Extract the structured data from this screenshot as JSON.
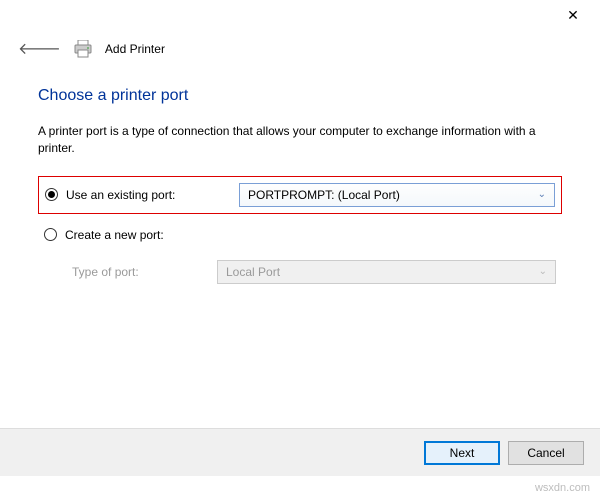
{
  "window": {
    "header_title": "Add Printer"
  },
  "page": {
    "title": "Choose a printer port",
    "description": "A printer port is a type of connection that allows your computer to exchange information with a printer."
  },
  "options": {
    "existing": {
      "label": "Use an existing port:",
      "selected_value": "PORTPROMPT: (Local Port)"
    },
    "create": {
      "label": "Create a new port:",
      "type_label": "Type of port:",
      "type_value": "Local Port"
    }
  },
  "buttons": {
    "next": "Next",
    "cancel": "Cancel"
  },
  "watermark": "wsxdn.com"
}
